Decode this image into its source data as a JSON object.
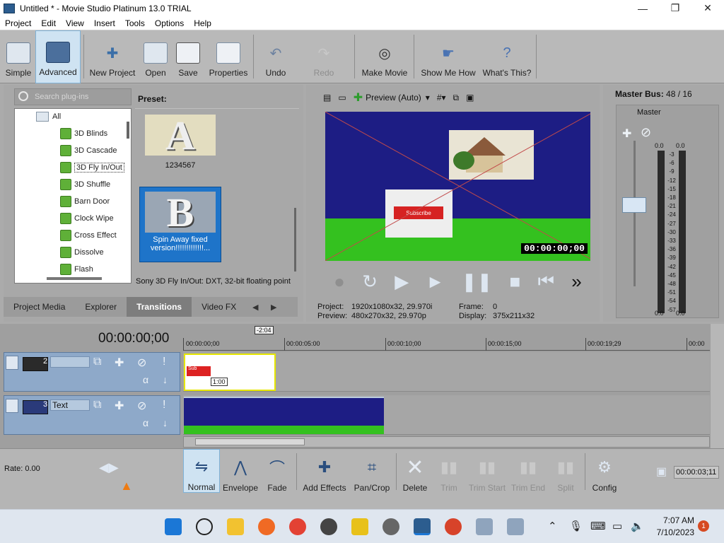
{
  "window": {
    "title": "Untitled * - Movie Studio Platinum 13.0 TRIAL"
  },
  "menu": [
    "Project",
    "Edit",
    "View",
    "Insert",
    "Tools",
    "Options",
    "Help"
  ],
  "toolbar": {
    "simple": "Simple",
    "advanced": "Advanced",
    "new_project": "New Project",
    "open": "Open",
    "save": "Save",
    "properties": "Properties",
    "undo": "Undo",
    "redo": "Redo",
    "make_movie": "Make Movie",
    "show_me_how": "Show Me How",
    "whats_this": "What's This?"
  },
  "plugins": {
    "search_placeholder": "Search plug-ins",
    "tree": [
      "All",
      "3D Blinds",
      "3D Cascade",
      "3D Fly In/Out",
      "3D Shuffle",
      "Barn Door",
      "Clock Wipe",
      "Cross Effect",
      "Dissolve",
      "Flash"
    ],
    "selected": "3D Fly In/Out"
  },
  "presets": {
    "label": "Preset:",
    "items": [
      {
        "letter": "A",
        "caption": "1234567"
      },
      {
        "letter": "B",
        "caption": "Spin Away fixed version!!!!!!!!!!!!!..."
      }
    ],
    "description": "Sony 3D Fly In/Out: DXT, 32-bit floating point"
  },
  "left_tabs": [
    "Project Media",
    "Explorer",
    "Transitions",
    "Video FX"
  ],
  "left_tabs_active": "Transitions",
  "preview": {
    "mode": "Preview (Auto)",
    "timecode": "00:00:00;00",
    "overlay_text": "Subscribe",
    "info": {
      "project_label": "Project:",
      "project_value": "1920x1080x32, 29.970i",
      "preview_label": "Preview:",
      "preview_value": "480x270x32, 29.970p",
      "frame_label": "Frame:",
      "frame_value": "0",
      "display_label": "Display:",
      "display_value": "375x211x32"
    }
  },
  "master": {
    "title_bold": "Master Bus:",
    "title_value": "48 / 16",
    "name": "Master",
    "top_left": "0.0",
    "top_right": "0.0",
    "bottom_left": "0.0",
    "bottom_right": "0.0",
    "scale": [
      "3",
      "6",
      "9",
      "12",
      "15",
      "18",
      "21",
      "24",
      "27",
      "30",
      "33",
      "36",
      "39",
      "42",
      "45",
      "48",
      "51",
      "54",
      "57"
    ]
  },
  "timeline": {
    "timecode": "00:00:00;00",
    "offset": "-2:04",
    "ruler": [
      "00:00:00;00",
      "00:00:05:00",
      "00:00:10;00",
      "00:00:15;00",
      "00:00:19;29",
      "00:00"
    ],
    "tracks": [
      {
        "number": "2",
        "name": ""
      },
      {
        "number": "3",
        "name": "Text"
      }
    ],
    "clip_badge": "1:00",
    "clip_sub": "Sub"
  },
  "bottom": {
    "rate": "Rate: 0.00",
    "normal": "Normal",
    "envelope": "Envelope",
    "fade": "Fade",
    "add_effects": "Add Effects",
    "pan_crop": "Pan/Crop",
    "delete": "Delete",
    "trim": "Trim",
    "trim_start": "Trim Start",
    "trim_end": "Trim End",
    "split": "Split",
    "config": "Config",
    "time": "00:00:03;11"
  },
  "taskbar": {
    "time": "7:07 AM",
    "date": "7/10/2023",
    "notifications": "1"
  },
  "colors": {
    "accent": "#1e74c9",
    "panel": "#a8a8a8",
    "track": "#8ea9c9"
  }
}
